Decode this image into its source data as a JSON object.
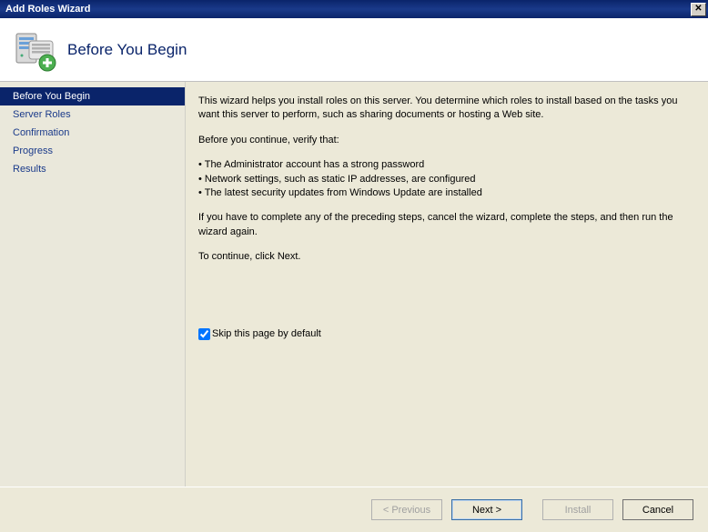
{
  "window": {
    "title": "Add Roles Wizard"
  },
  "header": {
    "title": "Before You Begin"
  },
  "sidebar": {
    "items": [
      {
        "label": "Before You Begin",
        "selected": true
      },
      {
        "label": "Server Roles",
        "selected": false
      },
      {
        "label": "Confirmation",
        "selected": false
      },
      {
        "label": "Progress",
        "selected": false
      },
      {
        "label": "Results",
        "selected": false
      }
    ]
  },
  "content": {
    "intro": "This wizard helps you install roles on this server. You determine which roles to install based on the tasks you want this server to perform, such as sharing documents or hosting a Web site.",
    "verify_heading": "Before you continue, verify that:",
    "bullets": [
      "The Administrator account has a strong password",
      "Network settings, such as static IP addresses, are configured",
      "The latest security updates from Windows Update are installed"
    ],
    "complete_note": "If you have to complete any of the preceding steps, cancel the wizard, complete the steps, and then run the wizard again.",
    "continue_note": "To continue, click Next.",
    "skip_checkbox": {
      "label": "Skip this page by default",
      "checked": true
    }
  },
  "footer": {
    "previous": "< Previous",
    "next": "Next >",
    "install": "Install",
    "cancel": "Cancel"
  }
}
